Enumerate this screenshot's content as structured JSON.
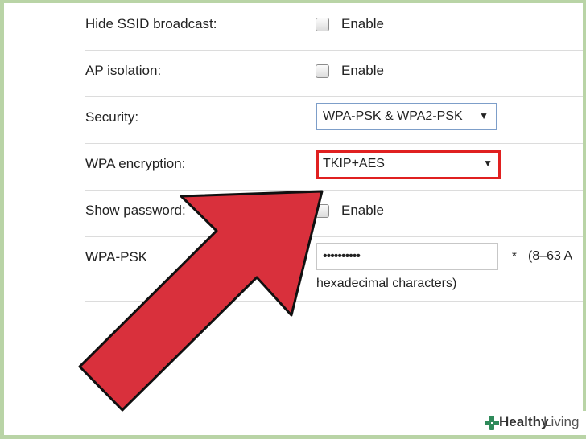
{
  "settings": {
    "hide_ssid": {
      "label": "Hide SSID broadcast:",
      "option": "Enable"
    },
    "ap_isolation": {
      "label": "AP isolation:",
      "option": "Enable"
    },
    "security": {
      "label": "Security:",
      "value": "WPA-PSK & WPA2-PSK"
    },
    "wpa_encryption": {
      "label": "WPA encryption:",
      "value": "TKIP+AES"
    },
    "show_password": {
      "label": "Show password:",
      "option": "Enable"
    },
    "wpa_psk": {
      "label": "WPA-PSK",
      "value": "••••••••••",
      "required_mark": "*",
      "hint": "(8–63 A",
      "hint_line2": "hexadecimal characters)"
    }
  },
  "icons": {
    "select_arrow": "▼",
    "overlay": "red-pointer-arrow-icon",
    "brand_logo": "healthy-living-plus-icon"
  },
  "colors": {
    "highlight_border": "#e02020",
    "arrow_fill": "#d9303c",
    "page_background": "#b9d4a6"
  },
  "watermark": {
    "brand_bold": "Healthy",
    "brand_light": "Living"
  }
}
